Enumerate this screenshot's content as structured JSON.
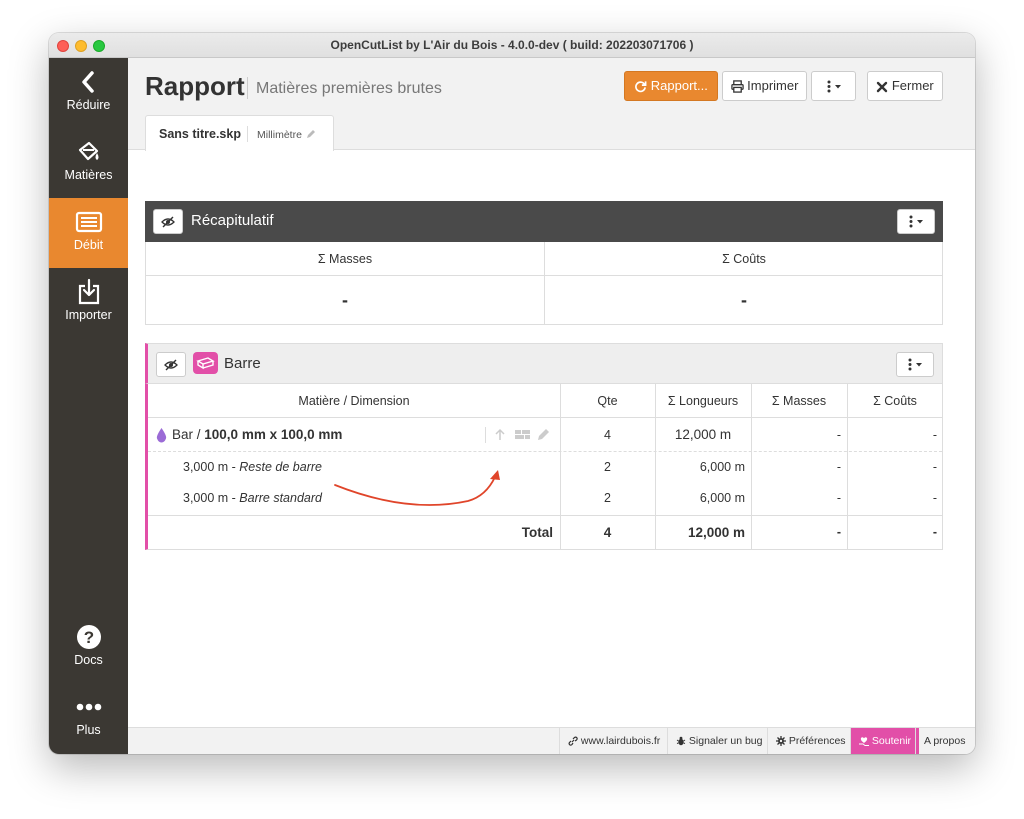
{
  "window": {
    "title": "OpenCutList by L'Air du Bois - 4.0.0-dev ( build: 202203071706 )"
  },
  "sidebar": {
    "items": [
      {
        "label": "Réduire",
        "icon": "chevron-left-icon"
      },
      {
        "label": "Matières",
        "icon": "paint-bucket-icon"
      },
      {
        "label": "Débit",
        "icon": "cutlist-icon",
        "active": true
      },
      {
        "label": "Importer",
        "icon": "import-icon"
      }
    ],
    "bottom": [
      {
        "label": "Docs",
        "icon": "help-icon"
      },
      {
        "label": "Plus",
        "icon": "more-icon"
      }
    ]
  },
  "header": {
    "title": "Rapport",
    "subtitle": "Matières premières brutes",
    "report_button": "Rapport...",
    "print_button": "Imprimer",
    "close_button": "Fermer"
  },
  "tab": {
    "filename": "Sans titre.skp",
    "unit": "Millimètre"
  },
  "summary": {
    "title": "Récapitulatif",
    "col_masses": "Σ Masses",
    "col_costs": "Σ Coûts",
    "val_masses": "-",
    "val_costs": "-"
  },
  "barre": {
    "title": "Barre",
    "headers": [
      "Matière / Dimension",
      "Qte",
      "Σ Longueurs",
      "Σ Masses",
      "Σ Coûts"
    ],
    "group": {
      "material": "Bar",
      "sep": " / ",
      "dimension": "100,0 mm x 100,0 mm",
      "qty": "4",
      "length": "12,000 m",
      "masses": "-",
      "costs": "-"
    },
    "rows": [
      {
        "length_prefix": "3,000 m - ",
        "label": "Reste de barre",
        "qty": "2",
        "length": "6,000 m",
        "masses": "-",
        "costs": "-"
      },
      {
        "length_prefix": "3,000 m - ",
        "label": "Barre standard",
        "qty": "2",
        "length": "6,000 m",
        "masses": "-",
        "costs": "-"
      }
    ],
    "total": {
      "label": "Total",
      "qty": "4",
      "length": "12,000 m",
      "masses": "-",
      "costs": "-"
    }
  },
  "footer": {
    "website": "www.lairdubois.fr",
    "bug": "Signaler un bug",
    "prefs": "Préférences",
    "support": "Soutenir",
    "about": "A propos"
  },
  "colors": {
    "accent": "#e9882f",
    "sidebar": "#3b3833",
    "pink": "#e24fa8",
    "material": "#9b6bd6",
    "arrow": "#e0452a"
  }
}
